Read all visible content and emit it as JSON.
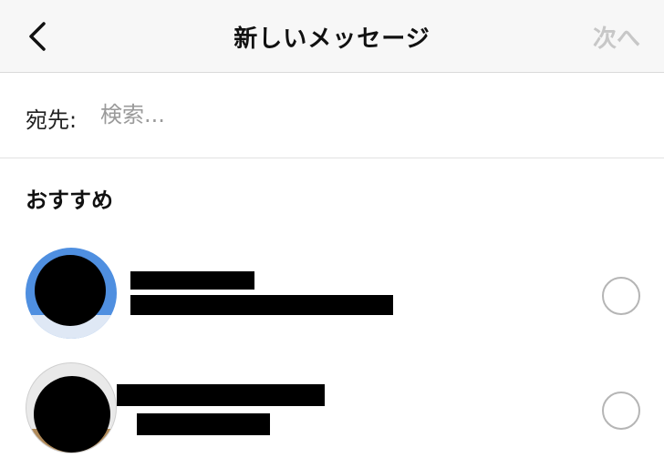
{
  "header": {
    "title": "新しいメッセージ",
    "next_label": "次へ",
    "back_icon": "chevron-left-icon",
    "next_color": "#c7c7c7"
  },
  "to": {
    "label": "宛先:",
    "placeholder": "検索..."
  },
  "suggested": {
    "title": "おすすめ",
    "contacts": [
      {
        "name_redacted": true,
        "subtitle_redacted": true,
        "selected": false
      },
      {
        "name_redacted": true,
        "subtitle_redacted": true,
        "selected": false
      }
    ]
  }
}
